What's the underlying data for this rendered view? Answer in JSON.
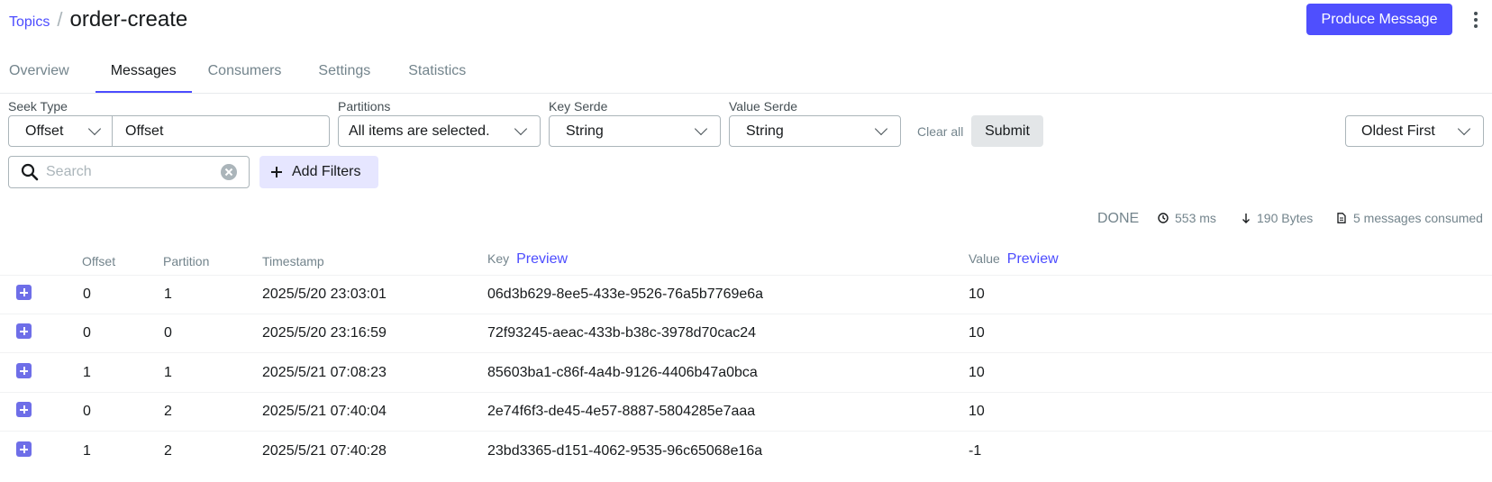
{
  "breadcrumb": {
    "parent": "Topics",
    "separator": "/",
    "current": "order-create"
  },
  "header": {
    "produce_label": "Produce Message"
  },
  "tabs": [
    {
      "label": "Overview",
      "active": false
    },
    {
      "label": "Messages",
      "active": true
    },
    {
      "label": "Consumers",
      "active": false
    },
    {
      "label": "Settings",
      "active": false
    },
    {
      "label": "Statistics",
      "active": false
    }
  ],
  "filters": {
    "seek_type": {
      "label": "Seek Type",
      "value": "Offset",
      "input_value": "Offset"
    },
    "partitions": {
      "label": "Partitions",
      "value": "All items are selected."
    },
    "key_serde": {
      "label": "Key Serde",
      "value": "String"
    },
    "value_serde": {
      "label": "Value Serde",
      "value": "String"
    },
    "clear_all_label": "Clear all",
    "submit_label": "Submit",
    "sort": {
      "value": "Oldest First"
    },
    "search_placeholder": "Search",
    "add_filters_label": "Add Filters"
  },
  "stats": {
    "status": "DONE",
    "elapsed": "553 ms",
    "bytes": "190 Bytes",
    "consumed": "5 messages consumed"
  },
  "table": {
    "columns": {
      "offset": "Offset",
      "partition": "Partition",
      "timestamp": "Timestamp",
      "key": "Key",
      "value": "Value",
      "preview": "Preview"
    },
    "rows": [
      {
        "offset": "0",
        "partition": "1",
        "timestamp": "2025/5/20 23:03:01",
        "key": "06d3b629-8ee5-433e-9526-76a5b7769e6a",
        "value": "10"
      },
      {
        "offset": "0",
        "partition": "0",
        "timestamp": "2025/5/20 23:16:59",
        "key": "72f93245-aeac-433b-b38c-3978d70cac24",
        "value": "10"
      },
      {
        "offset": "1",
        "partition": "1",
        "timestamp": "2025/5/21 07:08:23",
        "key": "85603ba1-c86f-4a4b-9126-4406b47a0bca",
        "value": "10"
      },
      {
        "offset": "0",
        "partition": "2",
        "timestamp": "2025/5/21 07:40:04",
        "key": "2e74f6f3-de45-4e57-8887-5804285e7aaa",
        "value": "10"
      },
      {
        "offset": "1",
        "partition": "2",
        "timestamp": "2025/5/21 07:40:28",
        "key": "23bd3365-d151-4062-9535-96c65068e16a",
        "value": "-1"
      }
    ]
  },
  "colors": {
    "accent": "#4f4ffe",
    "link": "#4c4cff",
    "expand": "#6e6ee8"
  }
}
